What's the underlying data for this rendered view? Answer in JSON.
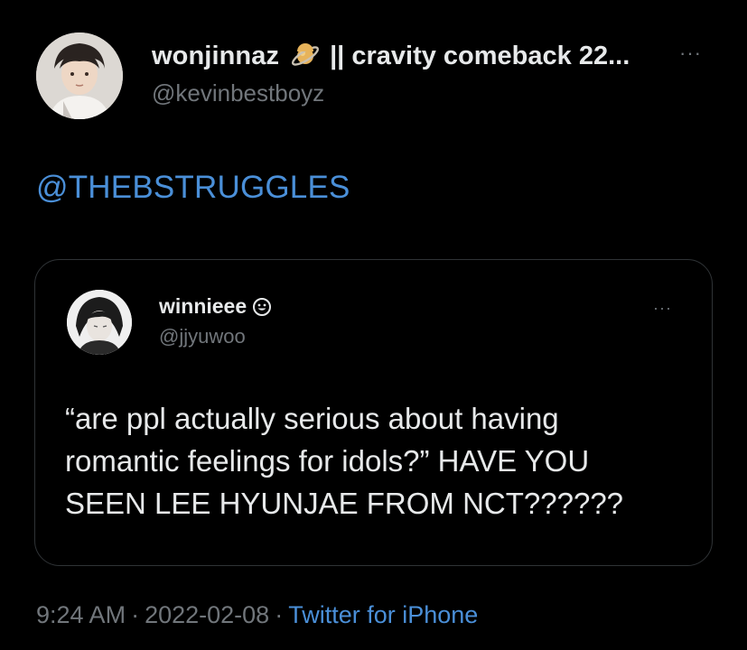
{
  "author": {
    "display_name": "wonjinnaz",
    "display_name_rest": "|| cravity comeback 22...",
    "handle": "@kevinbestboyz",
    "emoji_icon": "ringed-planet-icon"
  },
  "tweet": {
    "text": "@THEBSTRUGGLES"
  },
  "quoted_tweet": {
    "display_name": "winnieee",
    "name_icon": "smiley-face-icon",
    "handle": "@jjyuwoo",
    "text": "“are ppl actually serious about having\nromantic feelings for idols?” HAVE YOU\nSEEN LEE HYUNJAE FROM NCT??????"
  },
  "meta": {
    "time": "9:24 AM",
    "separator": "·",
    "date": "2022-02-08",
    "source": "Twitter for iPhone"
  },
  "icons": {
    "more": "···"
  },
  "colors": {
    "background": "#000000",
    "text_primary": "#e7e9ea",
    "text_secondary": "#71767b",
    "link": "#4a8fd8",
    "border": "#2f3336"
  }
}
